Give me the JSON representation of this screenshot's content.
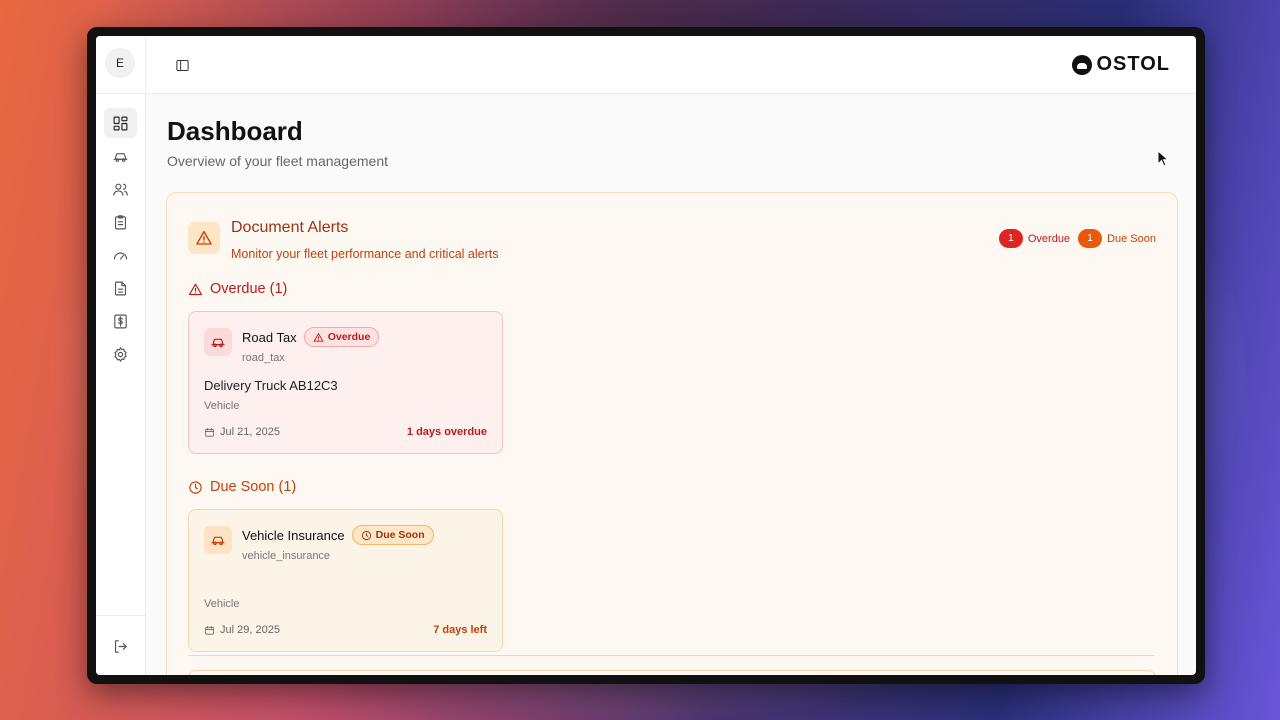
{
  "sidebar": {
    "avatar_initial": "E",
    "nav_items": [
      {
        "icon": "dashboard-icon",
        "active": true
      },
      {
        "icon": "car-icon",
        "active": false
      },
      {
        "icon": "users-icon",
        "active": false
      },
      {
        "icon": "clipboard-icon",
        "active": false
      },
      {
        "icon": "gauge-icon",
        "active": false
      },
      {
        "icon": "document-icon",
        "active": false
      },
      {
        "icon": "dollar-icon",
        "active": false
      },
      {
        "icon": "settings-icon",
        "active": false
      }
    ],
    "logout_icon": "logout-icon"
  },
  "topbar": {
    "toggle_icon": "sidebar-toggle-icon",
    "logo_text": "OSTOL"
  },
  "page": {
    "title": "Dashboard",
    "subtitle": "Overview of your fleet management"
  },
  "alerts": {
    "title": "Document Alerts",
    "subtitle": "Monitor your fleet performance and critical alerts",
    "overdue_count": "1",
    "overdue_label": "Overdue",
    "due_soon_count": "1",
    "due_soon_label": "Due Soon",
    "overdue_section_title": "Overdue (1)",
    "due_soon_section_title": "Due Soon (1)",
    "overdue_items": [
      {
        "title": "Road Tax",
        "badge": "Overdue",
        "code": "road_tax",
        "vehicle_name": "Delivery Truck AB12C3",
        "type": "Vehicle",
        "date": "Jul 21, 2025",
        "status_text": "1 days overdue"
      }
    ],
    "due_soon_items": [
      {
        "title": "Vehicle Insurance",
        "badge": "Due Soon",
        "code": "vehicle_insurance",
        "vehicle_name": "",
        "type": "Vehicle",
        "date": "Jul 29, 2025",
        "status_text": "7 days left"
      }
    ]
  },
  "colors": {
    "overdue": "#dc2626",
    "due_soon": "#ea580c",
    "alert_panel_bg": "#fdf8f2"
  }
}
